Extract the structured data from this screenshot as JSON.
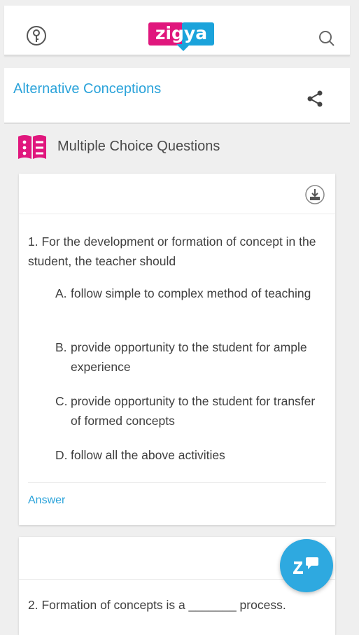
{
  "header": {
    "logo_text": "zigya",
    "key_icon": "key-icon",
    "search_icon": "search-icon"
  },
  "page_title": "Alternative Conceptions",
  "share_icon": "share-icon",
  "section": {
    "icon": "list-icon",
    "label": "Multiple Choice Questions"
  },
  "questions": [
    {
      "text": "1. For the development or formation of concept in the student, the teacher should",
      "options": [
        {
          "letter": "A.",
          "text": "follow simple to complex method of teaching"
        },
        {
          "letter": "B.",
          "text": "provide opportunity to the student for ample experience"
        },
        {
          "letter": "C.",
          "text": "provide opportunity to the student for transfer of formed concepts"
        },
        {
          "letter": "D.",
          "text": "follow all the above activities"
        }
      ],
      "answer_label": "Answer"
    },
    {
      "text": "2. Formation of concepts is a _______ process."
    }
  ],
  "colors": {
    "accent": "#2ba3da",
    "brand_pink": "#e0177d",
    "brand_blue": "#1ba3db",
    "background": "#efefef"
  }
}
